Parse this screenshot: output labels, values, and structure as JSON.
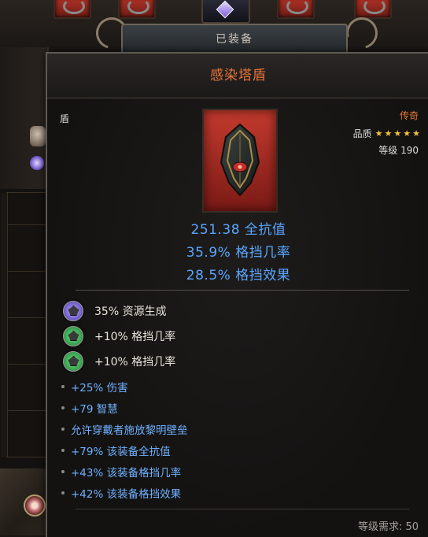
{
  "header": {
    "tab_label": "已装备"
  },
  "item": {
    "name": "感染塔盾",
    "type": "盾",
    "rarity": "传奇",
    "quality_label": "品质",
    "quality_stars": 5,
    "level_label": "等级 190",
    "base_stats": [
      "251.38 全抗值",
      "35.9% 格挡几率",
      "28.5% 格挡效果"
    ],
    "affixes": [
      {
        "text": "35% 资源生成",
        "icon": "purple-gem-icon"
      },
      {
        "text": "+10% 格挡几率",
        "icon": "green-gem-icon"
      },
      {
        "text": "+10% 格挡几率",
        "icon": "green-gem-icon"
      }
    ],
    "mods": [
      "+25% 伤害",
      "+79 智慧",
      "允许穿戴者施放黎明壁垒",
      "+79% 该装备全抗值",
      "+43% 该装备格挡几率",
      "+42% 该装备格挡效果"
    ],
    "requirement": "等级需求: 50"
  },
  "colors": {
    "legendary": "#e8743a",
    "stat_blue": "#5aa6ff",
    "item_bg": "#c43a2e"
  }
}
